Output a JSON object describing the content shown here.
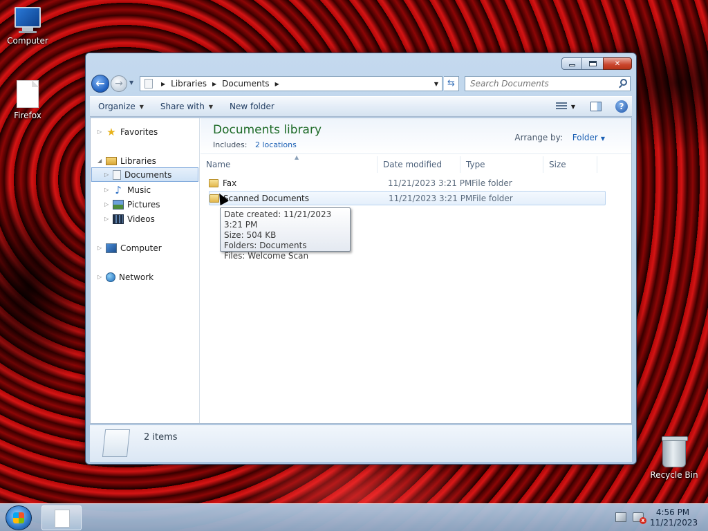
{
  "desktop": {
    "icons": [
      {
        "label": "Computer"
      },
      {
        "label": "Firefox"
      },
      {
        "label": "Recycle Bin"
      }
    ]
  },
  "window": {
    "address": {
      "crumbs": [
        "Libraries",
        "Documents"
      ]
    },
    "search": {
      "placeholder": "Search Documents"
    },
    "commandbar": {
      "organize": "Organize",
      "share_with": "Share with",
      "new_folder": "New folder"
    },
    "nav_pane": {
      "favorites": "Favorites",
      "libraries": "Libraries",
      "documents": "Documents",
      "music": "Music",
      "pictures": "Pictures",
      "videos": "Videos",
      "computer": "Computer",
      "network": "Network"
    },
    "library": {
      "title": "Documents library",
      "includes_label": "Includes:",
      "includes_link": "2 locations",
      "arrange_label": "Arrange by:",
      "arrange_value": "Folder"
    },
    "columns": [
      "Name",
      "Date modified",
      "Type",
      "Size"
    ],
    "rows": [
      {
        "name": "Fax",
        "date": "11/21/2023 3:21 PM",
        "type": "File folder",
        "size": ""
      },
      {
        "name": "Scanned Documents",
        "date": "11/21/2023 3:21 PM",
        "type": "File folder",
        "size": ""
      }
    ],
    "tooltip": {
      "line1": "Date created: 11/21/2023 3:21 PM",
      "line2": "Size: 504 KB",
      "line3": "Folders: Documents",
      "line4": "Files: Welcome Scan"
    },
    "status": {
      "item_count": "2 items"
    }
  },
  "taskbar": {
    "clock_time": "4:56 PM",
    "clock_date": "11/21/2023"
  }
}
